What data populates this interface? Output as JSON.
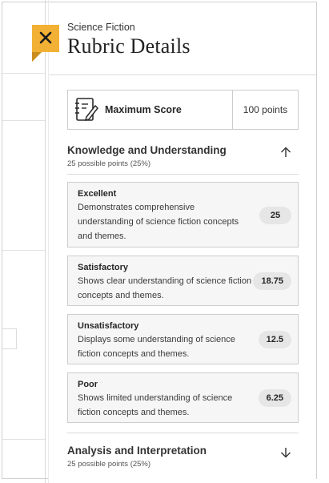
{
  "panel": {
    "subtitle": "Science Fiction",
    "title": "Rubric Details",
    "close_icon": "close-icon",
    "accent_color": "#f2b134"
  },
  "max_score": {
    "icon": "rubric-edit-icon",
    "label": "Maximum Score",
    "value": "100 points"
  },
  "criteria": [
    {
      "title": "Knowledge and Understanding",
      "possible": "25 possible points (25%)",
      "toggle_icon": "arrow-up-icon",
      "expanded": true,
      "levels": [
        {
          "name": "Excellent",
          "description": "Demonstrates comprehensive understanding of science fiction concepts and themes.",
          "points": "25"
        },
        {
          "name": "Satisfactory",
          "description": "Shows clear understanding of science fiction concepts and themes.",
          "points": "18.75"
        },
        {
          "name": "Unsatisfactory",
          "description": "Displays some understanding of science fiction concepts and themes.",
          "points": "12.5"
        },
        {
          "name": "Poor",
          "description": "Shows limited understanding of science fiction concepts and themes.",
          "points": "6.25"
        }
      ]
    },
    {
      "title": "Analysis and Interpretation",
      "possible": "25 possible points (25%)",
      "toggle_icon": "arrow-down-icon",
      "expanded": false
    }
  ]
}
